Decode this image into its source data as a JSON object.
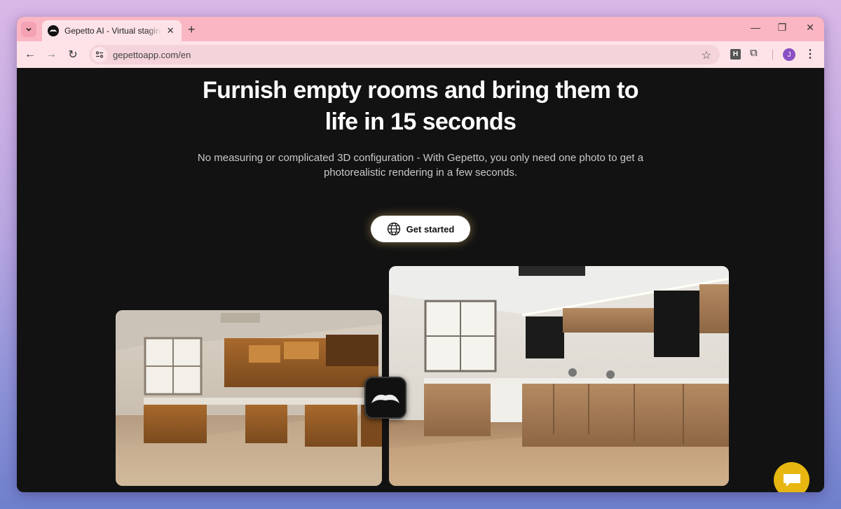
{
  "browser": {
    "tab_title": "Gepetto AI - Virtual staging and",
    "url": "gepettoapp.com/en",
    "profile_initial": "J",
    "extension_h": "H"
  },
  "hero": {
    "headline_line1": "Furnish empty rooms and bring them to",
    "headline_line2": "life in 15 seconds",
    "subtitle_line1": "No measuring or complicated 3D configuration - With Gepetto, you only need one photo to get a",
    "subtitle_line2": "photorealistic rendering in a few seconds.",
    "cta_label": "Get started"
  },
  "colors": {
    "tab_strip": "#fbb6c3",
    "toolbar": "#fde3e8",
    "page_bg": "#121212",
    "chat_accent": "#e8b611"
  }
}
